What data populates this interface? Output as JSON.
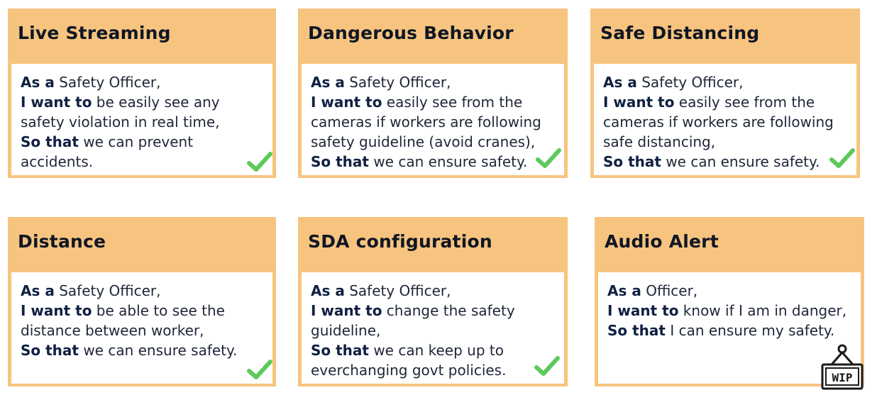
{
  "cards": [
    {
      "title": "Live Streaming",
      "lines": [
        {
          "b": "As a",
          "t": " Safety Officer,"
        },
        {
          "b": "I want to",
          "t": " be easily see any"
        },
        {
          "b": "",
          "t": "safety violation in real time,"
        },
        {
          "b": "So that",
          "t": " we can prevent"
        },
        {
          "b": "",
          "t": "accidents."
        }
      ],
      "status": "check-icon"
    },
    {
      "title": "Dangerous Behavior",
      "lines": [
        {
          "b": "As a",
          "t": " Safety Officer,"
        },
        {
          "b": "I want to",
          "t": " easily see from the"
        },
        {
          "b": "",
          "t": "cameras if workers are following"
        },
        {
          "b": "",
          "t": "safety guideline (avoid cranes),"
        },
        {
          "b": "So that",
          "t": " we can ensure safety."
        }
      ],
      "status": "check-icon"
    },
    {
      "title": "Safe Distancing",
      "lines": [
        {
          "b": "As a",
          "t": " Safety Officer,"
        },
        {
          "b": "I want to",
          "t": " easily see from the"
        },
        {
          "b": "",
          "t": "cameras if workers are following"
        },
        {
          "b": "",
          "t": "safe distancing,"
        },
        {
          "b": "So that",
          "t": " we can ensure safety."
        }
      ],
      "status": "check-icon"
    },
    {
      "title": "Distance",
      "lines": [
        {
          "b": "As a",
          "t": " Safety Officer,"
        },
        {
          "b": "I want to",
          "t": " be able to see the"
        },
        {
          "b": "",
          "t": "distance between worker,"
        },
        {
          "b": "So that",
          "t": " we can ensure safety."
        }
      ],
      "status": "check-icon"
    },
    {
      "title": "SDA configuration",
      "lines": [
        {
          "b": "As a",
          "t": " Safety Officer,"
        },
        {
          "b": "I want to",
          "t": " change the safety"
        },
        {
          "b": "",
          "t": "guideline,"
        },
        {
          "b": "So that",
          "t": " we can keep up to"
        },
        {
          "b": "",
          "t": "everchanging govt policies."
        }
      ],
      "status": "check-icon"
    },
    {
      "title": "Audio Alert",
      "lines": [
        {
          "b": "As a",
          "t": " Officer,"
        },
        {
          "b": "I want to",
          "t": " know if I am in danger,"
        },
        {
          "b": "So that",
          "t": " I can ensure my safety."
        }
      ],
      "status": "wip-sign-icon",
      "status_label": "WIP"
    }
  ],
  "colors": {
    "header": "#f7c47f",
    "check": "#5cc95a",
    "title_text": "#101624",
    "body_text": "#1e2638"
  }
}
